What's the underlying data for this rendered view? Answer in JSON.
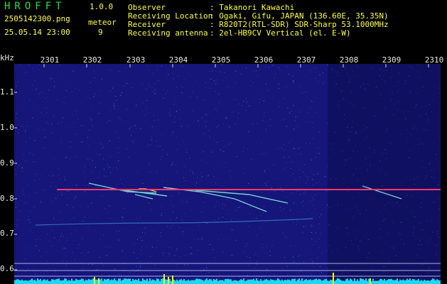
{
  "header": {
    "app_name": "HROFFT",
    "app_version": "1.0.0",
    "filename": "2505142300.png",
    "datetime": "25.05.14 23:00",
    "meteor_label": "meteor",
    "meteor_count": "9",
    "fields": [
      {
        "label": "Observer",
        "value": ": Takanori Kawachi"
      },
      {
        "label": "Receiving Location",
        "value": ": Ogaki, Gifu, JAPAN (136.60E, 35.35N)"
      },
      {
        "label": "Receiver",
        "value": ": R820T2(RTL-SDR) SDR-Sharp 53.1000MHz"
      },
      {
        "label": "Receiving antenna",
        "value": ": 2el-HB9CV Vertical (el. E-W)"
      }
    ]
  },
  "axes": {
    "y_unit": "kHz",
    "x_ticks": [
      "2301",
      "2302",
      "2303",
      "2304",
      "2305",
      "2306",
      "2307",
      "2308",
      "2309",
      "2310"
    ],
    "y_ticks": [
      "1.1",
      "1.0",
      "0.9",
      "0.8",
      "0.7",
      "0.6"
    ]
  },
  "colors": {
    "background": "#15157a",
    "carrier": "#ff3a6a",
    "trail": "#7fe6d8",
    "noise_floor": "#19d8f0",
    "spike": "#ffff00",
    "label_yellow": "#ffff3a",
    "label_green": "#23e04a"
  }
}
